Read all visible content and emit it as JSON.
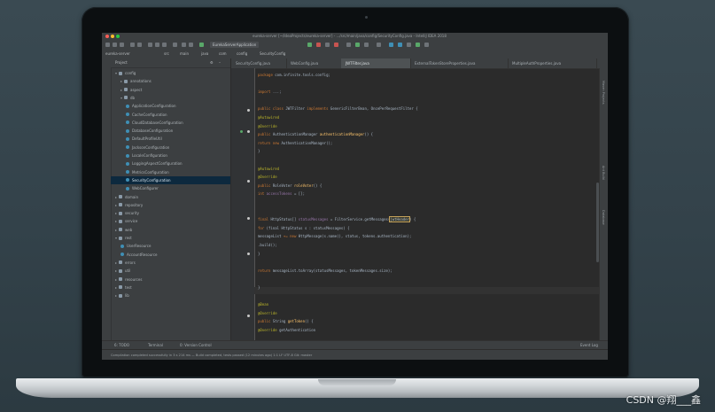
{
  "window": {
    "title": "eureka-server [~/IdeaProjects/eureka-server] - .../src/main/java/config/SecurityConfig.java - IntelliJ IDEA 2018",
    "traffic_colors": [
      "#ff5f57",
      "#febc2e",
      "#28c840"
    ]
  },
  "toolbar": {
    "run_config": "EurekaServerApplication"
  },
  "navbar": {
    "crumbs": [
      "eureka-server",
      "src",
      "main",
      "java",
      "com",
      "config",
      "SecurityConfig"
    ]
  },
  "sidebar": {
    "header": "Project",
    "items": [
      {
        "label": "config",
        "type": "folder",
        "indent": 0,
        "arrow": "▾"
      },
      {
        "label": "annotations",
        "type": "folder",
        "indent": 1,
        "arrow": "▸"
      },
      {
        "label": "aspect",
        "type": "folder",
        "indent": 1,
        "arrow": "▸"
      },
      {
        "label": "db",
        "type": "folder",
        "indent": 1,
        "arrow": "▾"
      },
      {
        "label": "ApplicationConfiguration",
        "type": "class",
        "indent": 2,
        "arrow": ""
      },
      {
        "label": "CacheConfiguration",
        "type": "class",
        "indent": 2,
        "arrow": ""
      },
      {
        "label": "CloudDatabaseConfiguration",
        "type": "class",
        "indent": 2,
        "arrow": ""
      },
      {
        "label": "DatabaseConfiguration",
        "type": "class",
        "indent": 2,
        "arrow": ""
      },
      {
        "label": "DefaultProfileUtil",
        "type": "class",
        "indent": 2,
        "arrow": ""
      },
      {
        "label": "JacksonConfiguration",
        "type": "class",
        "indent": 2,
        "arrow": ""
      },
      {
        "label": "LocaleConfiguration",
        "type": "class",
        "indent": 2,
        "arrow": ""
      },
      {
        "label": "LoggingAspectConfiguration",
        "type": "class",
        "indent": 2,
        "arrow": ""
      },
      {
        "label": "MetricsConfiguration",
        "type": "class",
        "indent": 2,
        "arrow": ""
      },
      {
        "label": "SecurityConfiguration",
        "type": "class",
        "indent": 2,
        "arrow": "",
        "selected": true
      },
      {
        "label": "WebConfigurer",
        "type": "class",
        "indent": 2,
        "arrow": ""
      },
      {
        "label": "domain",
        "type": "folder",
        "indent": 0,
        "arrow": "▸"
      },
      {
        "label": "repository",
        "type": "folder",
        "indent": 0,
        "arrow": "▸"
      },
      {
        "label": "security",
        "type": "folder",
        "indent": 0,
        "arrow": "▸"
      },
      {
        "label": "service",
        "type": "folder",
        "indent": 0,
        "arrow": "▸"
      },
      {
        "label": "web",
        "type": "folder",
        "indent": 0,
        "arrow": "▸"
      },
      {
        "label": "rest",
        "type": "folder",
        "indent": 0,
        "arrow": "▾"
      },
      {
        "label": "UserResource",
        "type": "class",
        "indent": 1,
        "arrow": ""
      },
      {
        "label": "AccountResource",
        "type": "class",
        "indent": 1,
        "arrow": ""
      },
      {
        "label": "errors",
        "type": "folder",
        "indent": 0,
        "arrow": "▸"
      },
      {
        "label": "util",
        "type": "folder",
        "indent": 0,
        "arrow": "▸"
      },
      {
        "label": "resources",
        "type": "folder",
        "indent": 0,
        "arrow": "▸"
      },
      {
        "label": "test",
        "type": "folder",
        "indent": 0,
        "arrow": "▸"
      },
      {
        "label": "lib",
        "type": "folder",
        "indent": 0,
        "arrow": "▸"
      }
    ]
  },
  "editor": {
    "tabs": [
      {
        "label": "SecurityConfig.java",
        "active": false
      },
      {
        "label": "WebConfig.java",
        "active": false
      },
      {
        "label": "JWTFilter.java",
        "active": true
      },
      {
        "label": "ExternalTokenStoreProperties.java",
        "active": false
      },
      {
        "label": "MultipleAuthProperties.java",
        "active": false
      }
    ],
    "code": [
      {
        "parts": [
          {
            "c": "kw",
            "t": "package "
          },
          {
            "c": "tx",
            "t": "com.infinite.tools.config;"
          }
        ]
      },
      {
        "parts": []
      },
      {
        "parts": [
          {
            "c": "kw",
            "t": "import "
          },
          {
            "c": "tx",
            "t": "...;"
          }
        ]
      },
      {
        "parts": []
      },
      {
        "parts": [
          {
            "c": "kw",
            "t": "public class "
          },
          {
            "c": "tx",
            "t": "JWTFilter "
          },
          {
            "c": "kw",
            "t": "implements "
          },
          {
            "c": "tx",
            "t": "GenericFilterBean, OncePerRequestFilter {"
          }
        ]
      },
      {
        "parts": [
          {
            "c": "an",
            "t": "    @Autowired"
          }
        ]
      },
      {
        "parts": [
          {
            "c": "an",
            "t": "    @Override"
          }
        ]
      },
      {
        "parts": [
          {
            "c": "kw",
            "t": "    public "
          },
          {
            "c": "tx",
            "t": "AuthenticationManager "
          },
          {
            "c": "fn",
            "t": "authenticationManager"
          },
          {
            "c": "tx",
            "t": "() {"
          }
        ]
      },
      {
        "parts": [
          {
            "c": "kw",
            "t": "        return "
          },
          {
            "c": "kw",
            "t": "new "
          },
          {
            "c": "tx",
            "t": "AuthenticationManager();"
          }
        ]
      },
      {
        "parts": [
          {
            "c": "tx",
            "t": "    }"
          }
        ]
      },
      {
        "parts": []
      },
      {
        "parts": [
          {
            "c": "an",
            "t": "    @Autowired"
          }
        ]
      },
      {
        "parts": [
          {
            "c": "an",
            "t": "    @Override"
          }
        ]
      },
      {
        "parts": [
          {
            "c": "kw",
            "t": "    public "
          },
          {
            "c": "tx",
            "t": "RoleVoter "
          },
          {
            "c": "fn",
            "t": "roleVoter"
          },
          {
            "c": "tx",
            "t": "() {"
          }
        ]
      },
      {
        "parts": [
          {
            "c": "kw",
            "t": "        int "
          },
          {
            "c": "fd",
            "t": "accessTokens"
          },
          {
            "c": "tx",
            "t": " = [];"
          }
        ]
      },
      {
        "parts": []
      },
      {
        "parts": []
      },
      {
        "parts": [
          {
            "c": "kw",
            "t": "        final "
          },
          {
            "c": "tx",
            "t": "HttpStatus[] "
          },
          {
            "c": "fd",
            "t": "statusMessages"
          },
          {
            "c": "tx",
            "t": " = FilterService.getMessages("
          },
          {
            "c": "tx",
            "t": "jwtHeader"
          },
          {
            "c": "tx",
            "t": ") {"
          }
        ]
      },
      {
        "parts": [
          {
            "c": "kw",
            "t": "        for "
          },
          {
            "c": "tx",
            "t": "(final HttpStatus s : statusMessages) {"
          }
        ]
      },
      {
        "parts": [
          {
            "c": "tx",
            "t": "            messageList "
          },
          {
            "c": "kw",
            "t": "+= new "
          },
          {
            "c": "tx",
            "t": "HttpMessage(s.name(), status, tokens.authentication);"
          }
        ]
      },
      {
        "parts": [
          {
            "c": "tx",
            "t": "                .build();"
          }
        ]
      },
      {
        "parts": [
          {
            "c": "tx",
            "t": "        }"
          }
        ]
      },
      {
        "parts": []
      },
      {
        "parts": [
          {
            "c": "kw",
            "t": "        return "
          },
          {
            "c": "tx",
            "t": "messageList.toArray(statusMessages, tokenMessages.size);"
          }
        ]
      },
      {
        "parts": []
      },
      {
        "parts": [
          {
            "c": "tx",
            "t": "    }"
          }
        ]
      },
      {
        "parts": []
      },
      {
        "parts": [
          {
            "c": "an",
            "t": "    @Bean"
          }
        ]
      },
      {
        "parts": [
          {
            "c": "an",
            "t": "    @Override"
          }
        ]
      },
      {
        "parts": [
          {
            "c": "kw",
            "t": "    public "
          },
          {
            "c": "tx",
            "t": "String "
          },
          {
            "c": "fn",
            "t": "getToken"
          },
          {
            "c": "tx",
            "t": "() {"
          }
        ]
      },
      {
        "parts": [
          {
            "c": "an",
            "t": "    @Override  "
          },
          {
            "c": "tx",
            "t": "getAuthentication"
          }
        ]
      }
    ],
    "highlight_word": "jwtHeader",
    "right_tools": [
      "Maven Projects",
      "Ant Build",
      "Database"
    ]
  },
  "bottom": {
    "tabs": [
      "6: TODO",
      "Terminal",
      "0: Version Control",
      "Event Log"
    ]
  },
  "status": {
    "text": "Compilation completed successfully in 3 s 214 ms — Build completed, tests passed (12 minutes ago)     1:1   LF   UTF-8   Git: master"
  },
  "watermark": "CSDN @翔___鑫"
}
